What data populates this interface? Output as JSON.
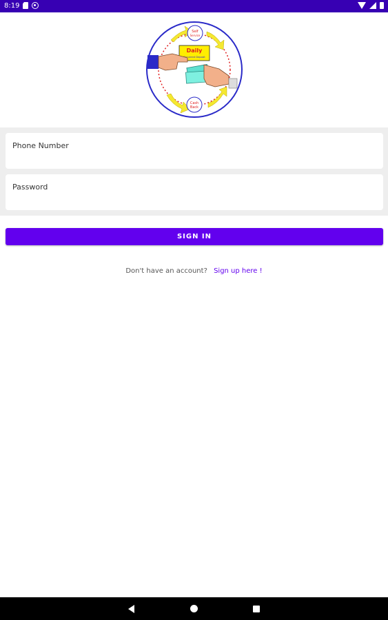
{
  "status_bar": {
    "time": "8:19",
    "icons": [
      "sd-card-icon",
      "at-sign-icon",
      "wifi-icon",
      "signal-icon",
      "battery-icon"
    ],
    "background": "#3700b3"
  },
  "logo": {
    "badge_title": "Daily",
    "badge_subtitle": "Recurrent Deposit",
    "top_label_line1": "Self",
    "top_label_line2": "Service",
    "bottom_label_line1": "Cash",
    "bottom_label_line2": "Back"
  },
  "form": {
    "phone_label": "Phone Number",
    "phone_value": "",
    "password_label": "Password",
    "password_value": ""
  },
  "sign_in": {
    "label": "SIGN IN"
  },
  "signup": {
    "prompt": "Don't have an account?",
    "link": "Sign up here !"
  },
  "colors": {
    "accent": "#6200ee",
    "status_bar": "#3700b3",
    "form_background": "#eeeeee"
  },
  "nav_bar": {
    "icons": [
      "back-icon",
      "home-icon",
      "recents-icon"
    ]
  }
}
